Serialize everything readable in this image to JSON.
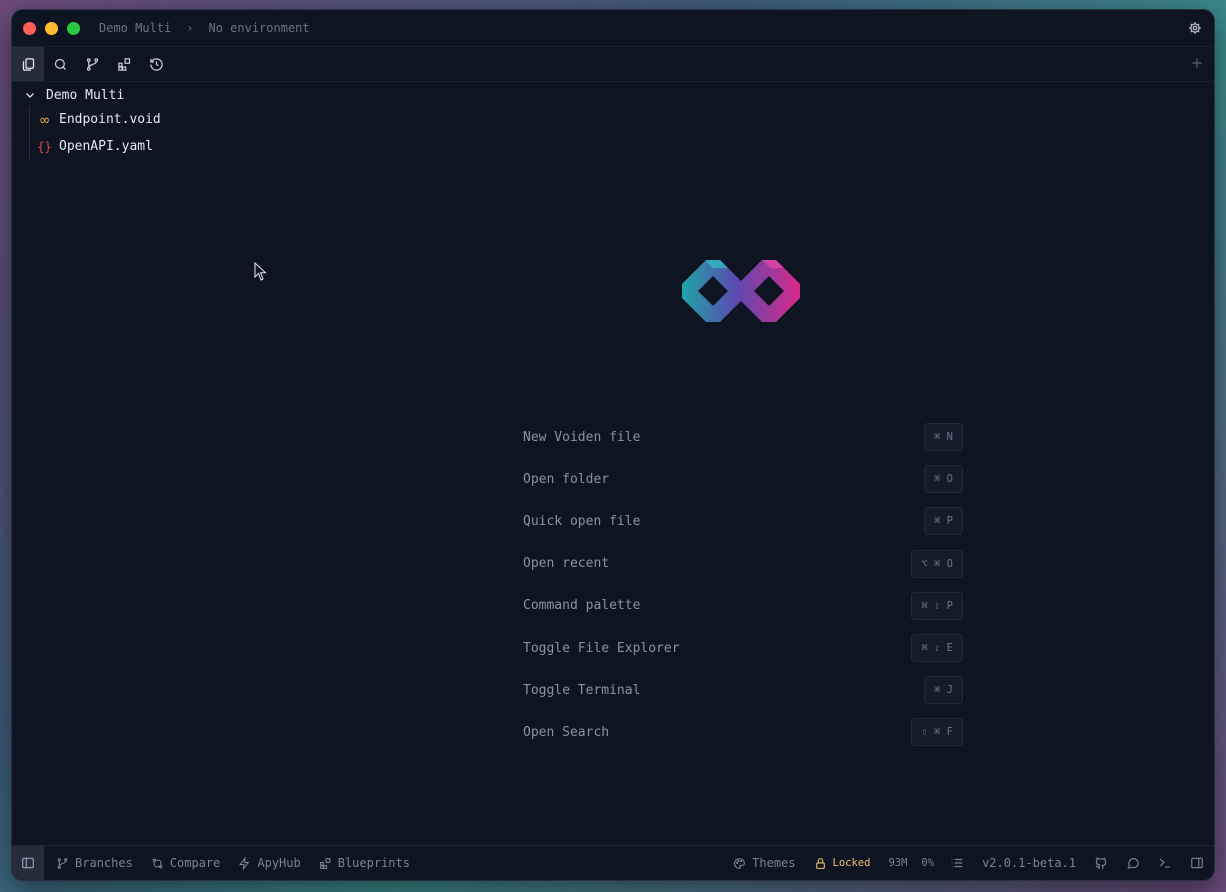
{
  "titlebar": {
    "project": "Demo Multi",
    "environment": "No environment"
  },
  "explorer": {
    "root": "Demo Multi",
    "files": [
      {
        "name": "Endpoint.void",
        "icon": "infinity-icon",
        "color": "#e0a030"
      },
      {
        "name": "OpenAPI.yaml",
        "icon": "braces-icon",
        "color": "#e04848"
      }
    ]
  },
  "shortcuts": [
    {
      "label": "New Voiden file",
      "keys": "⌘ N"
    },
    {
      "label": "Open folder",
      "keys": "⌘ O"
    },
    {
      "label": "Quick open file",
      "keys": "⌘ P"
    },
    {
      "label": "Open recent",
      "keys": "⌥ ⌘ O"
    },
    {
      "label": "Command palette",
      "keys": "⌘ ⇧ P"
    },
    {
      "label": "Toggle File Explorer",
      "keys": "⌘ ⇧ E"
    },
    {
      "label": "Toggle Terminal",
      "keys": "⌘ J"
    },
    {
      "label": "Open Search",
      "keys": "⇧ ⌘ F"
    }
  ],
  "statusbar": {
    "branches": "Branches",
    "compare": "Compare",
    "apyhub": "ApyHub",
    "blueprints": "Blueprints",
    "themes": "Themes",
    "locked": "Locked",
    "memory": "93M",
    "cpu": "0%",
    "version": "v2.0.1-beta.1"
  },
  "colors": {
    "background": "#0f1422",
    "accent_teal": "#2bb5b0",
    "accent_magenta": "#d8298a",
    "locked": "#e8c06a"
  }
}
